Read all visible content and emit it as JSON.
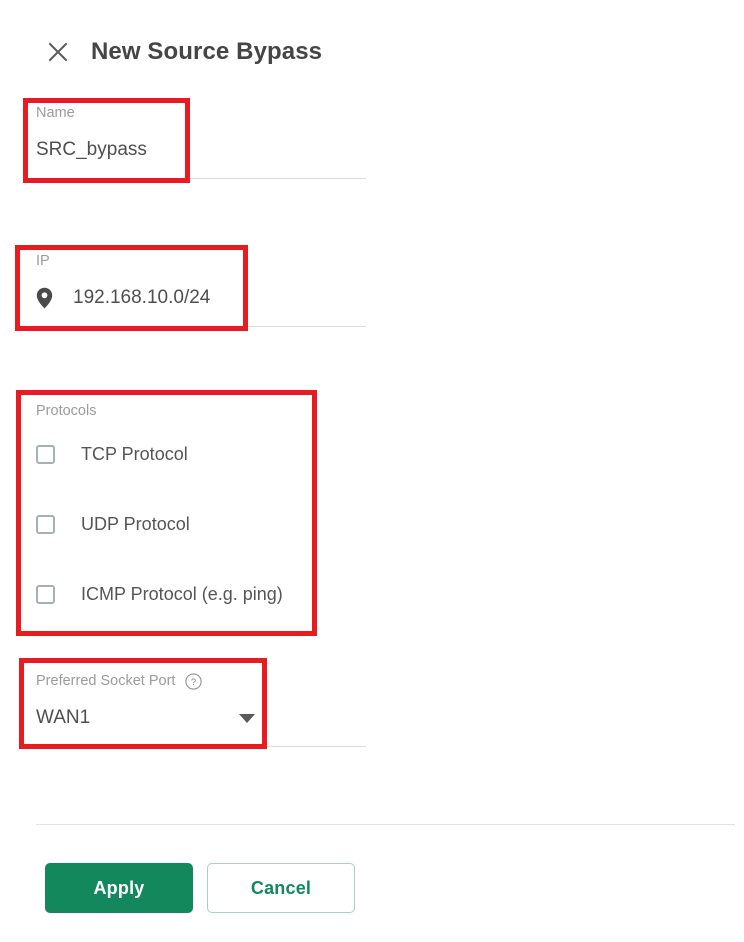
{
  "dialog": {
    "title": "New Source Bypass",
    "close_icon": "close-icon"
  },
  "form": {
    "name": {
      "label": "Name",
      "value": "SRC_bypass",
      "placeholder": "Name"
    },
    "ip": {
      "label": "IP",
      "value": "192.168.10.0/24",
      "placeholder": "IP",
      "icon": "location-pin-icon"
    },
    "protocols": {
      "label": "Protocols",
      "items": [
        {
          "label": "TCP Protocol",
          "checked": false
        },
        {
          "label": "UDP Protocol",
          "checked": false
        },
        {
          "label": "ICMP Protocol (e.g. ping)",
          "checked": false
        }
      ]
    },
    "socket_port": {
      "label": "Preferred Socket Port",
      "help_icon": "help-circle-icon",
      "value": "WAN1",
      "options": [
        "WAN1"
      ]
    }
  },
  "footer": {
    "apply_label": "Apply",
    "cancel_label": "Cancel"
  },
  "colors": {
    "primary_green": "#14885d",
    "cancel_border": "#a7d3c2",
    "annotation_red": "#e81c20",
    "label_gray": "#9b9b9b",
    "value_gray": "#4f4f4f",
    "checkbox_border": "#a3b2b2",
    "divider": "#e2e2e2"
  }
}
